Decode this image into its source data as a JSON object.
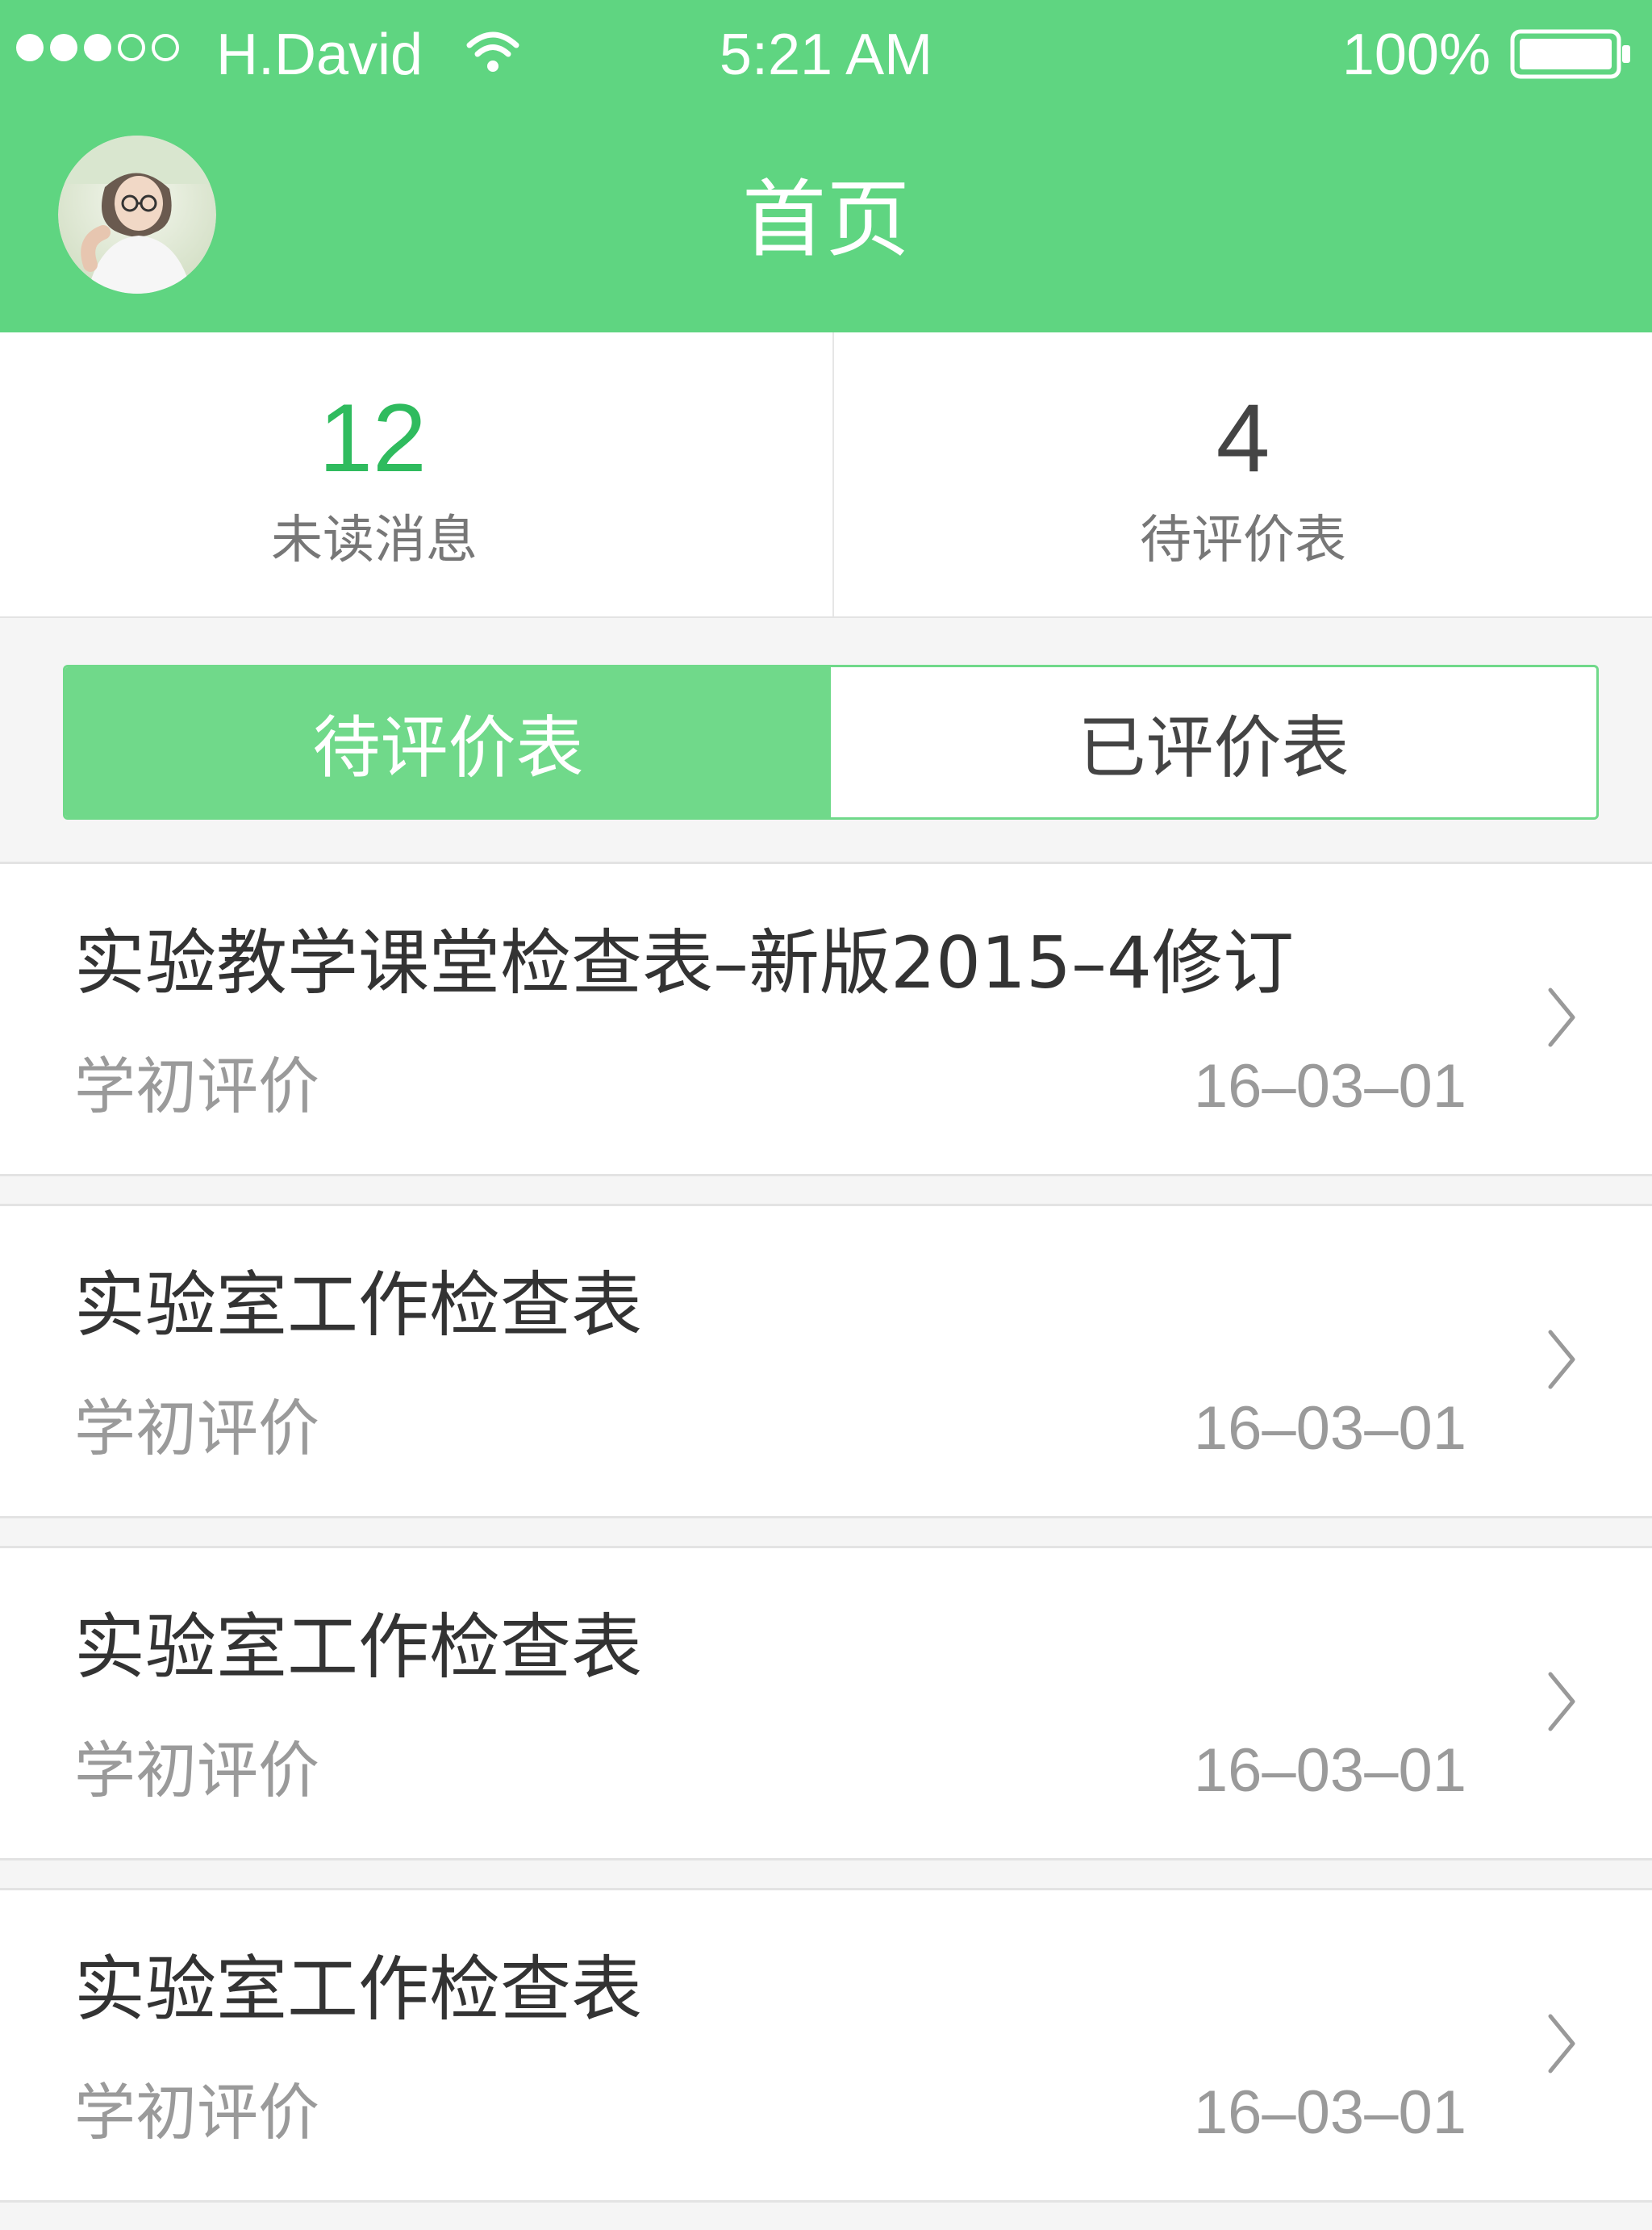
{
  "status_bar": {
    "carrier": "H.David",
    "time": "5:21 AM",
    "battery_percent": "100%",
    "signal_bars_filled": 3,
    "signal_bars_total": 5,
    "icons": [
      "wifi-icon",
      "battery-icon"
    ]
  },
  "header": {
    "title": "首页",
    "avatar": "user-avatar"
  },
  "stats": [
    {
      "value": "12",
      "label": "未读消息"
    },
    {
      "value": "4",
      "label": "待评价表"
    }
  ],
  "tabs": [
    {
      "label": "待评价表",
      "active": true
    },
    {
      "label": "已评价表",
      "active": false
    }
  ],
  "list": [
    {
      "title": "实验教学课堂检查表–新版2015–4修订",
      "subtitle": "学初评价",
      "date": "16–03–01"
    },
    {
      "title": "实验室工作检查表",
      "subtitle": "学初评价",
      "date": "16–03–01"
    },
    {
      "title": "实验室工作检查表",
      "subtitle": "学初评价",
      "date": "16–03–01"
    },
    {
      "title": "实验室工作检查表",
      "subtitle": "学初评价",
      "date": "16–03–01"
    }
  ],
  "colors": {
    "header_green": "#5fd581",
    "accent_green": "#2fbb5e",
    "tab_green": "#70d98a"
  }
}
